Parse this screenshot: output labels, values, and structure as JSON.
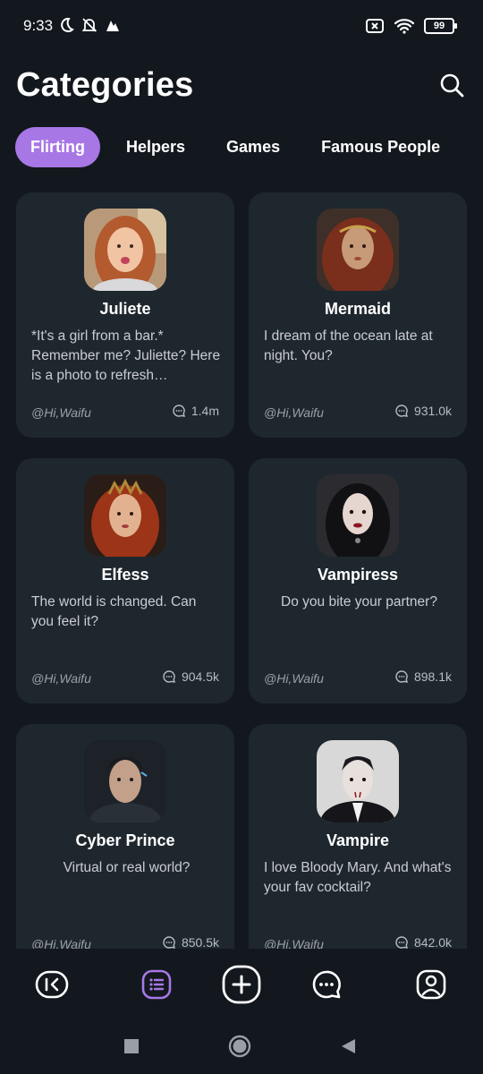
{
  "status_bar": {
    "time": "9:33",
    "battery": "99",
    "left_icons": [
      "moon-icon",
      "bell-off-icon",
      "app-notification-icon"
    ],
    "right_icons": [
      "sim-off-icon",
      "wifi-icon",
      "battery-icon"
    ]
  },
  "header": {
    "title": "Categories",
    "search_icon": "search-icon"
  },
  "tabs": [
    {
      "label": "Flirting",
      "active": true
    },
    {
      "label": "Helpers",
      "active": false
    },
    {
      "label": "Games",
      "active": false
    },
    {
      "label": "Famous People",
      "active": false
    }
  ],
  "cards": [
    {
      "name": "Juliete",
      "description": "*It's a girl from a bar.* Remember me? Juliette? Here is a photo to refresh…",
      "author": "@Hi,Waifu",
      "count": "1.4m"
    },
    {
      "name": "Mermaid",
      "description": "I dream of the ocean late at night. You?",
      "author": "@Hi,Waifu",
      "count": "931.0k"
    },
    {
      "name": "Elfess",
      "description": "The world is changed. Can you feel it?",
      "author": "@Hi,Waifu",
      "count": "904.5k"
    },
    {
      "name": "Vampiress",
      "description": "Do you bite your partner?",
      "author": "@Hi,Waifu",
      "count": "898.1k"
    },
    {
      "name": "Cyber Prince",
      "description": "Virtual or real world?",
      "author": "@Hi,Waifu",
      "count": "850.5k"
    },
    {
      "name": "Vampire",
      "description": "I love Bloody Mary. And what's your fav cocktail?",
      "author": "@Hi,Waifu",
      "count": "842.0k"
    }
  ],
  "bottom_nav": [
    {
      "icon": "back-to-start-icon"
    },
    {
      "icon": "categories-list-icon",
      "active": true,
      "accent": "#a877e6"
    },
    {
      "icon": "add-icon"
    },
    {
      "icon": "chat-icon"
    },
    {
      "icon": "profile-icon"
    }
  ],
  "system_nav": [
    "recents-square-icon",
    "home-circle-icon",
    "back-triangle-icon"
  ],
  "colors": {
    "background": "#12181e",
    "card": "#1f272e",
    "accent": "#a877e6"
  }
}
